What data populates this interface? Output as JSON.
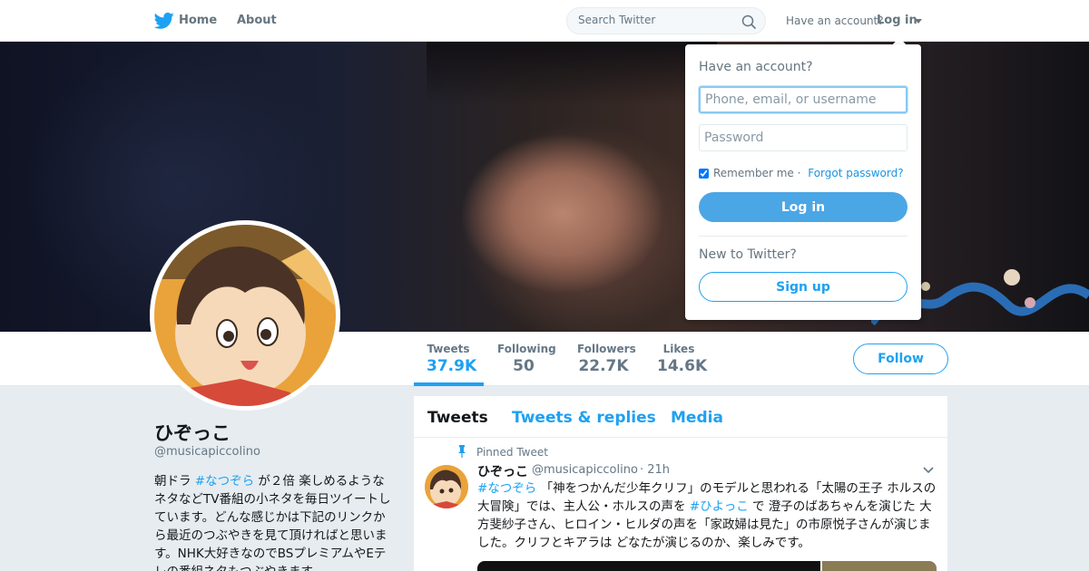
{
  "nav": {
    "brand_icon": "twitter-bird-icon",
    "home_label": "Home",
    "about_label": "About",
    "search_placeholder": "Search Twitter",
    "have_account_label": "Have an account?",
    "login_label": "Log in"
  },
  "profile": {
    "display_name": "ひぞっこ",
    "handle": "@musicapiccolino",
    "bio_parts": [
      "朝ドラ ",
      "#なつぞら",
      " が２倍 楽しめるようなネタなどTV番組の小ネタを毎日ツイートしています。どんな感じかは下記のリンクから最近のつぶやきを見て頂ければと思います。NHK大好きなのでBSプレミアムやEテレの番組ネタもつぶやきます。"
    ]
  },
  "stats": [
    {
      "label": "Tweets",
      "value": "37.9K",
      "active": true
    },
    {
      "label": "Following",
      "value": "50",
      "active": false
    },
    {
      "label": "Followers",
      "value": "22.7K",
      "active": false
    },
    {
      "label": "Likes",
      "value": "14.6K",
      "active": false
    }
  ],
  "follow_label": "Follow",
  "timeline": {
    "tabs": [
      "Tweets",
      "Tweets & replies",
      "Media"
    ],
    "pinned_label": "Pinned Tweet",
    "tweet": {
      "name": "ひぞっこ",
      "handle": "@musicapiccolino",
      "time": "· 21h",
      "text_parts": [
        "#なつぞら",
        " 「神をつかんだ少年クリフ」のモデルと思われる「太陽の王子 ホルスの大冒険」では、主人公・ホルスの声を ",
        "#ひよっこ",
        " で 澄子のばあちゃんを演じた 大方斐紗子さん、ヒロイン・ヒルダの声を「家政婦は見た」の市原悦子さんが演じました。クリフとキアラは どなたが演じるのか、楽しみです。"
      ]
    }
  },
  "login_dropdown": {
    "title": "Have an account?",
    "username_placeholder": "Phone, email, or username",
    "password_placeholder": "Password",
    "remember_label": "Remember me",
    "separator": " · ",
    "forgot_label": "Forgot password?",
    "login_button": "Log in",
    "new_label": "New to Twitter?",
    "signup_button": "Sign up"
  },
  "colors": {
    "accent": "#1da1f2",
    "login_button": "#4ba6e6",
    "background": "#e6ecf0"
  }
}
